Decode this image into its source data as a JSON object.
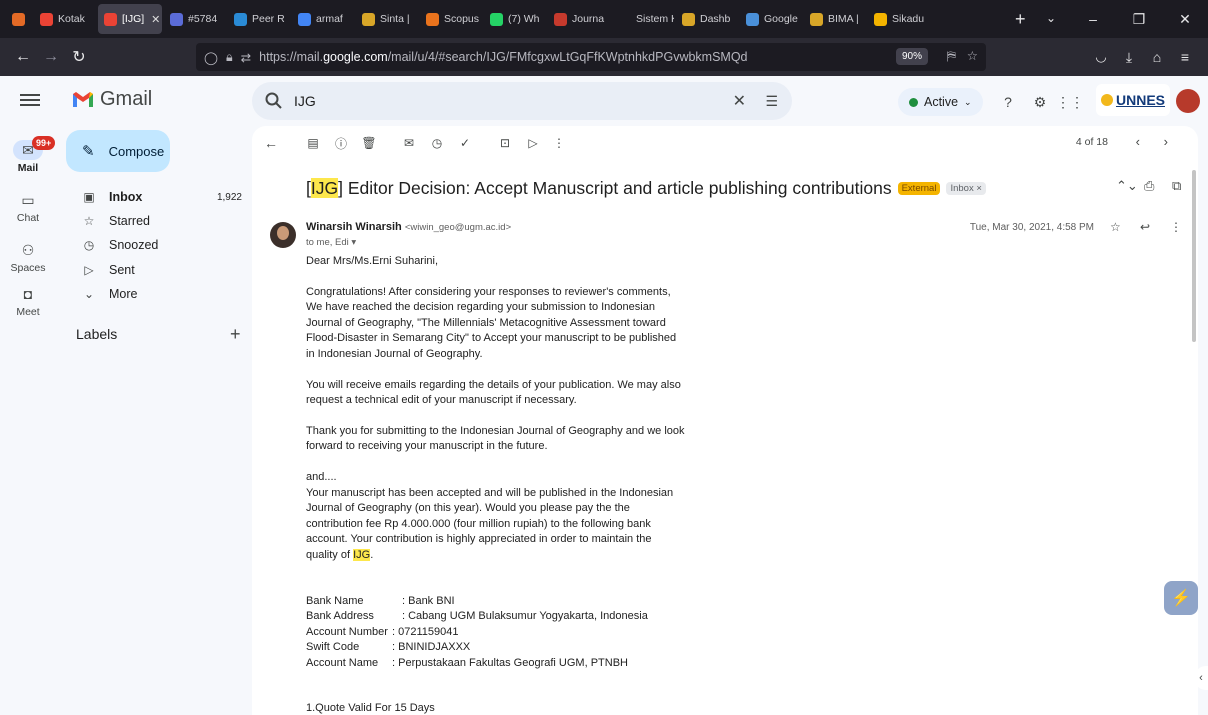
{
  "browser": {
    "tabs": [
      {
        "label": "",
        "color": "#e36a26",
        "active": false
      },
      {
        "label": "Kotak",
        "color": "#ea4335",
        "active": false
      },
      {
        "label": "[IJG]",
        "color": "#ea4335",
        "active": true
      },
      {
        "label": "#5784",
        "color": "#5b6cd8",
        "active": false
      },
      {
        "label": "Peer R",
        "color": "#2a8bd6",
        "active": false
      },
      {
        "label": "armaf",
        "color": "#4285f4",
        "active": false
      },
      {
        "label": "Sinta |",
        "color": "#d8a628",
        "active": false
      },
      {
        "label": "Scopus",
        "color": "#e9731d",
        "active": false
      },
      {
        "label": "(7) Wh",
        "color": "#25d366",
        "active": false
      },
      {
        "label": "Journa",
        "color": "#c63a2d",
        "active": false
      },
      {
        "label": "Sistem Kep",
        "color": "",
        "active": false
      },
      {
        "label": "Dashb",
        "color": "#d8a628",
        "active": false
      },
      {
        "label": "Google",
        "color": "#4a90d9",
        "active": false
      },
      {
        "label": "BIMA |",
        "color": "#d8a628",
        "active": false
      },
      {
        "label": "Sikadu",
        "color": "#f4b400",
        "active": false
      }
    ],
    "url_prefix": "https://mail.",
    "url_host": "google.com",
    "url_path": "/mail/u/4/#search/IJG/FMfcgxwLtGqFfKWptnhkdPGvwbkmSMQd",
    "zoom": "90%"
  },
  "gmail": {
    "brand": "Gmail",
    "search_value": "IJG",
    "status": "Active",
    "org_logo": "UNNES",
    "rail": [
      {
        "label": "Mail",
        "badge": "99+"
      },
      {
        "label": "Chat"
      },
      {
        "label": "Spaces"
      },
      {
        "label": "Meet"
      }
    ],
    "compose_label": "Compose",
    "nav": [
      {
        "label": "Inbox",
        "count": "1,922"
      },
      {
        "label": "Starred",
        "count": ""
      },
      {
        "label": "Snoozed",
        "count": ""
      },
      {
        "label": "Sent",
        "count": ""
      },
      {
        "label": "More",
        "count": ""
      }
    ],
    "labels_heading": "Labels",
    "pager": "4 of 18"
  },
  "message": {
    "subject_tag": "IJG",
    "subject_pre": "[",
    "subject_post": "] Editor Decision: Accept Manuscript and article publishing contributions",
    "chip_external": "External",
    "chip_inbox": "Inbox ×",
    "sender_name": "Winarsih Winarsih",
    "sender_email": "<wiwin_geo@ugm.ac.id>",
    "to_line": "to me, Edi ▾",
    "date": "Tue, Mar 30, 2021, 4:58 PM",
    "greeting": "Dear Mrs/Ms.Erni Suharini,",
    "para1": "Congratulations! After considering your responses to reviewer's comments, We have reached the decision regarding your submission to Indonesian Journal of Geography, \"The Millennials' Metacognitive Assessment toward Flood-Disaster in Semarang City\" to Accept your manuscript to be published in Indonesian Journal of Geography.",
    "para2": "You will receive emails regarding the details of your publication. We may also request a technical edit of your manuscript if necessary.",
    "para3": "Thank you for submitting to the Indonesian Journal of Geography and we look forward to receiving your manuscript in the future.",
    "and_line": "and....",
    "para4_pre": "Your manuscript has been accepted and will be published in the Indonesian Journal of Geography (on this year).  Would you please pay the the contribution fee Rp 4.000.000 (four million rupiah) to the following bank account.  Your contribution is highly appreciated in order to maintain the quality of ",
    "para4_tag": "IJG",
    "para4_post": ".",
    "bank": [
      {
        "label": "Bank Name",
        "value": ": Bank BNI"
      },
      {
        "label": "Bank Address",
        "value": ": Cabang UGM Bulaksumur Yogyakarta, Indonesia"
      },
      {
        "label": "Account Number",
        "value": ": 0721159041"
      },
      {
        "label": "Swift Code",
        "value": ": BNINIDJAXXX"
      },
      {
        "label": "Account Name",
        "value": ": Perpustakaan Fakultas Geografi UGM, PTNBH"
      }
    ],
    "quote_line": "1.Quote Valid For 15 Days"
  }
}
